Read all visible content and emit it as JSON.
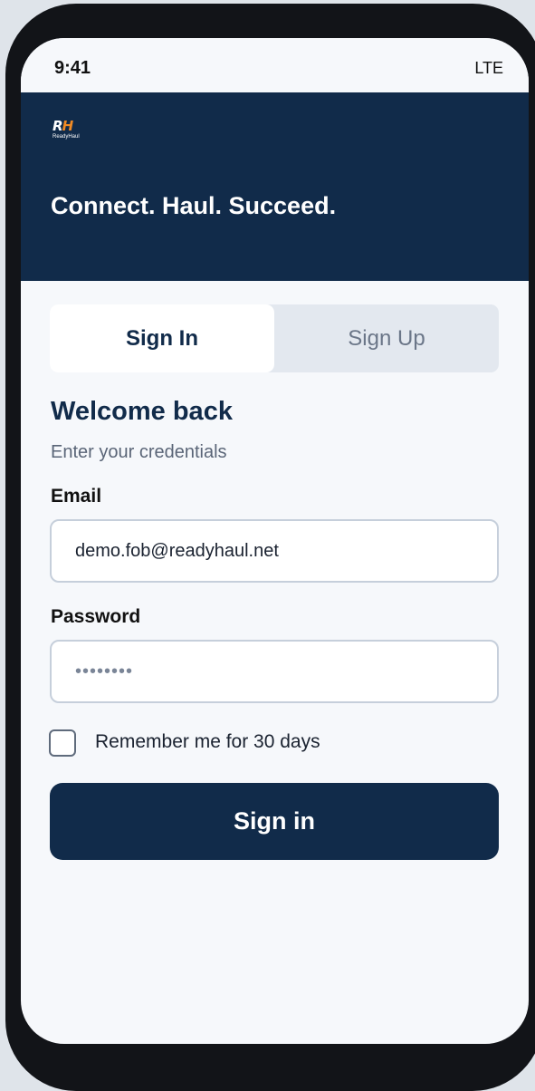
{
  "status_bar": {
    "time": "9:41",
    "network": "LTE"
  },
  "header": {
    "logo_mark_main": "R",
    "logo_mark_accent": "H",
    "logo_text": "ReadyHaul",
    "tagline": "Connect. Haul. Succeed."
  },
  "tabs": [
    {
      "label": "Sign In",
      "active": true
    },
    {
      "label": "Sign Up",
      "active": false
    }
  ],
  "form": {
    "title": "Welcome back",
    "subtitle": "Enter your credentials",
    "email_label": "Email",
    "email_value": "demo.fob@readyhaul.net",
    "password_label": "Password",
    "password_value": "••••••••",
    "remember_label": "Remember me for 30 days",
    "remember_checked": false,
    "submit_label": "Sign in"
  },
  "colors": {
    "brand_navy": "#112b4a",
    "logo_accent": "#f08a24",
    "screen_background": "#f6f8fb"
  }
}
